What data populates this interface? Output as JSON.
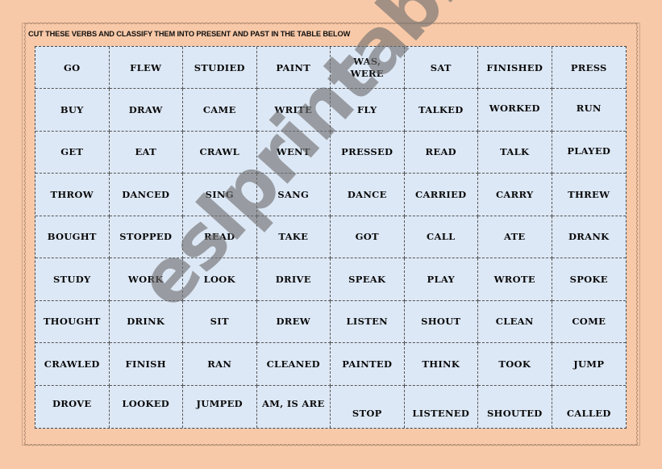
{
  "instruction": "CUT THESE VERBS AND CLASSIFY THEM INTO PRESENT AND PAST IN THE TABLE BELOW",
  "watermark": "eslprintables.com",
  "colors": {
    "page_background": "#f8c9a8",
    "card_background": "#dde8f6",
    "text": "#0a0a0a",
    "watermark": "#6e6e6e"
  },
  "cards": [
    [
      "GO",
      "FLEW",
      "STUDIED",
      "PAINT",
      "WAS, WERE",
      "SAT",
      "FINISHED",
      "PRESS"
    ],
    [
      "BUY",
      "DRAW",
      "CAME",
      "WRITE",
      "FLY",
      "TALKED",
      "WORKED",
      "RUN"
    ],
    [
      "GET",
      "EAT",
      "CRAWL",
      "WENT",
      "PRESSED",
      "READ",
      "TALK",
      "PLAYED"
    ],
    [
      "THROW",
      "DANCED",
      "SING",
      "SANG",
      "DANCE",
      "CARRIED",
      "CARRY",
      "THREW"
    ],
    [
      "BOUGHT",
      "STOPPED",
      "READ",
      "TAKE",
      "GOT",
      "CALL",
      "ATE",
      "DRANK"
    ],
    [
      "STUDY",
      "WORK",
      "LOOK",
      "DRIVE",
      "SPEAK",
      "PLAY",
      "WROTE",
      "SPOKE"
    ],
    [
      "THOUGHT",
      "DRINK",
      "SIT",
      "DREW",
      "LISTEN",
      "SHOUT",
      "CLEAN",
      "COME"
    ],
    [
      "CRAWLED",
      "FINISH",
      "RAN",
      "CLEANED",
      "PAINTED",
      "THINK",
      "TOOK",
      "JUMP"
    ],
    [
      "DROVE",
      "LOOKED",
      "JUMPED",
      "AM, IS ARE",
      "STOP",
      "LISTENED",
      "SHOUTED",
      "CALLED"
    ]
  ]
}
